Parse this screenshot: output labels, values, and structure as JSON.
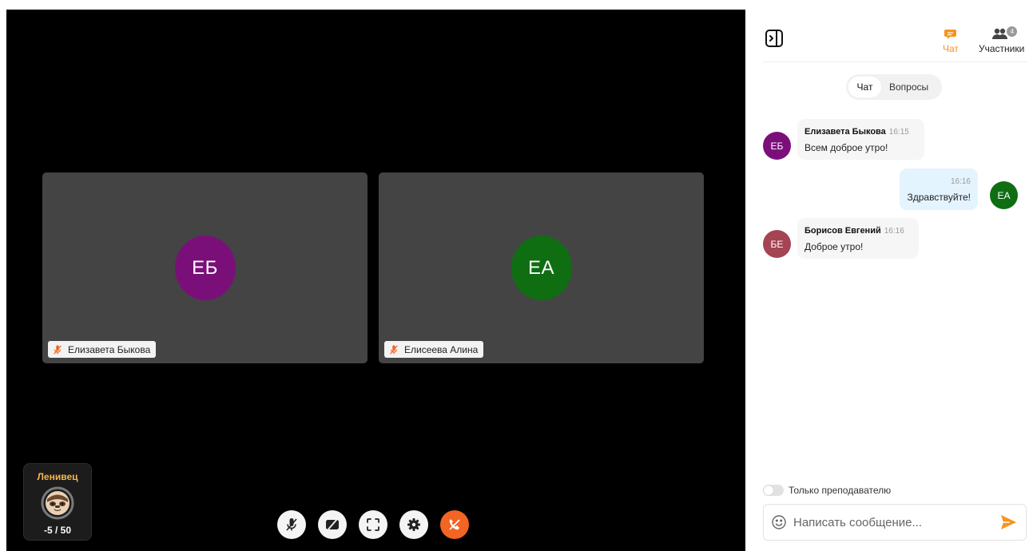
{
  "participants": [
    {
      "initials": "ЕБ",
      "name": "Елизавета Быкова",
      "color": "#7b0f7a"
    },
    {
      "initials": "ЕА",
      "name": "Елисеева Алина",
      "color": "#0f6e12"
    }
  ],
  "score": {
    "title": "Ленивец",
    "value": "-5 / 50",
    "icon": "sloth-icon"
  },
  "controls": [
    "mic-off-icon",
    "camera-off-icon",
    "fullscreen-icon",
    "gear-icon",
    "hangup-icon"
  ],
  "panel": {
    "tabs": {
      "chat": "Чат",
      "participants": "Участники",
      "participants_count": "4"
    },
    "segments": {
      "chat": "Чат",
      "questions": "Вопросы"
    },
    "messages": [
      {
        "author": "Елизавета Быкова",
        "initials": "ЕБ",
        "time": "16:15",
        "text": "Всем доброе утро!",
        "color": "#7b0f7a"
      },
      {
        "author": "",
        "initials": "ЕА",
        "time": "16:16",
        "text": "Здравствуйте!",
        "color": "#0f6e12"
      },
      {
        "author": "Борисов Евгений",
        "initials": "БЕ",
        "time": "16:16",
        "text": "Доброе утро!",
        "color": "#a54452"
      }
    ],
    "only_teacher_label": "Только преподавателю",
    "input_placeholder": "Написать сообщение..."
  },
  "colors": {
    "accent": "#f7931e",
    "hangup": "#f26522",
    "outgoing_bubble": "#e4f4ff"
  }
}
